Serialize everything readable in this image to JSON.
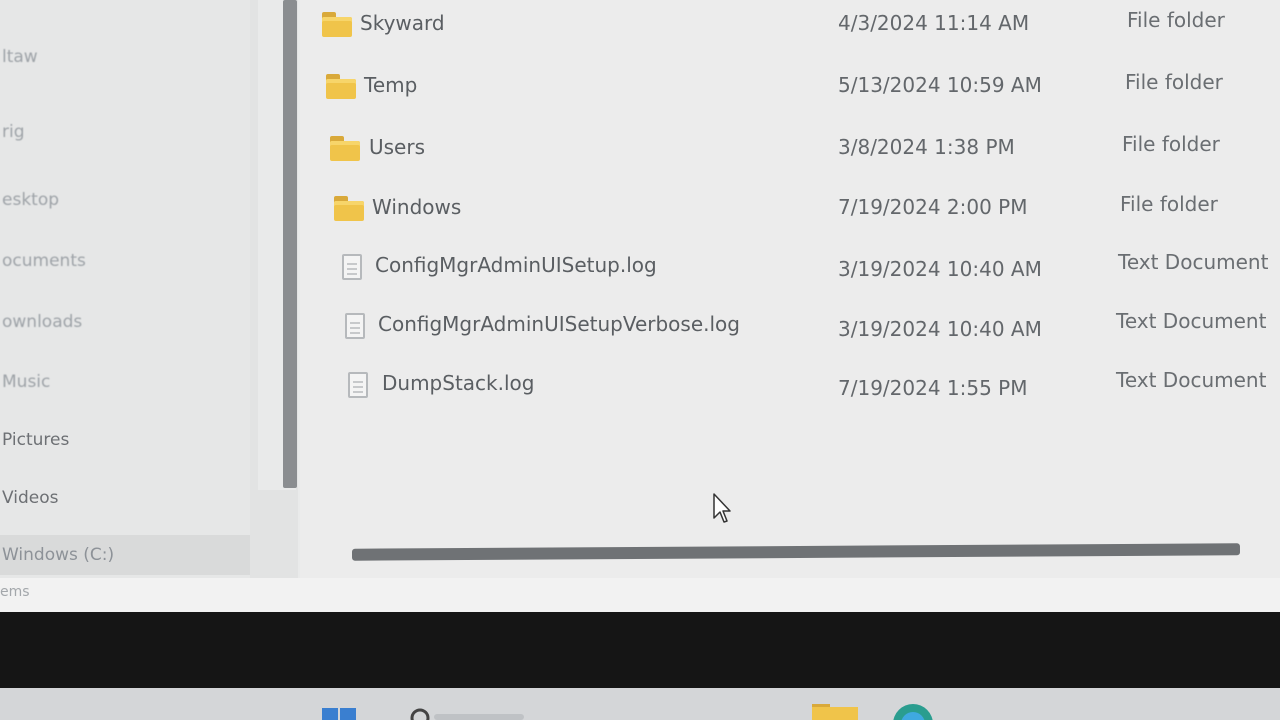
{
  "navigation": {
    "items": [
      {
        "label": "ltaw",
        "faded": true
      },
      {
        "label": "rig",
        "faded": true
      },
      {
        "label": "esktop",
        "faded": true
      },
      {
        "label": "ocuments",
        "faded": true
      },
      {
        "label": "ownloads",
        "faded": true
      },
      {
        "label": "Music",
        "faded": true
      },
      {
        "label": "Pictures",
        "faded": false
      },
      {
        "label": "Videos",
        "faded": false
      },
      {
        "label": "Windows (C:)",
        "faded": false,
        "selected": true
      }
    ]
  },
  "files": [
    {
      "name": "Skyward",
      "date": "4/3/2024 11:14 AM",
      "type": "File folder",
      "kind": "folder"
    },
    {
      "name": "Temp",
      "date": "5/13/2024 10:59 AM",
      "type": "File folder",
      "kind": "folder"
    },
    {
      "name": "Users",
      "date": "3/8/2024 1:38 PM",
      "type": "File folder",
      "kind": "folder"
    },
    {
      "name": "Windows",
      "date": "7/19/2024 2:00 PM",
      "type": "File folder",
      "kind": "folder"
    },
    {
      "name": "ConfigMgrAdminUISetup.log",
      "date": "3/19/2024 10:40 AM",
      "type": "Text Document",
      "kind": "document"
    },
    {
      "name": "ConfigMgrAdminUISetupVerbose.log",
      "date": "3/19/2024 10:40 AM",
      "type": "Text Document",
      "kind": "document"
    },
    {
      "name": "DumpStack.log",
      "date": "7/19/2024 1:55 PM",
      "type": "Text Document",
      "kind": "document"
    }
  ],
  "status": {
    "text": "ems"
  },
  "colors": {
    "folder": "#f0c44a",
    "folder_tab": "#d9a93a",
    "taskbar": "#d4d6d8",
    "bezel": "#151515"
  },
  "taskbar": {
    "icons": [
      "start-icon",
      "search-icon",
      "file-explorer-icon",
      "edge-icon"
    ]
  }
}
